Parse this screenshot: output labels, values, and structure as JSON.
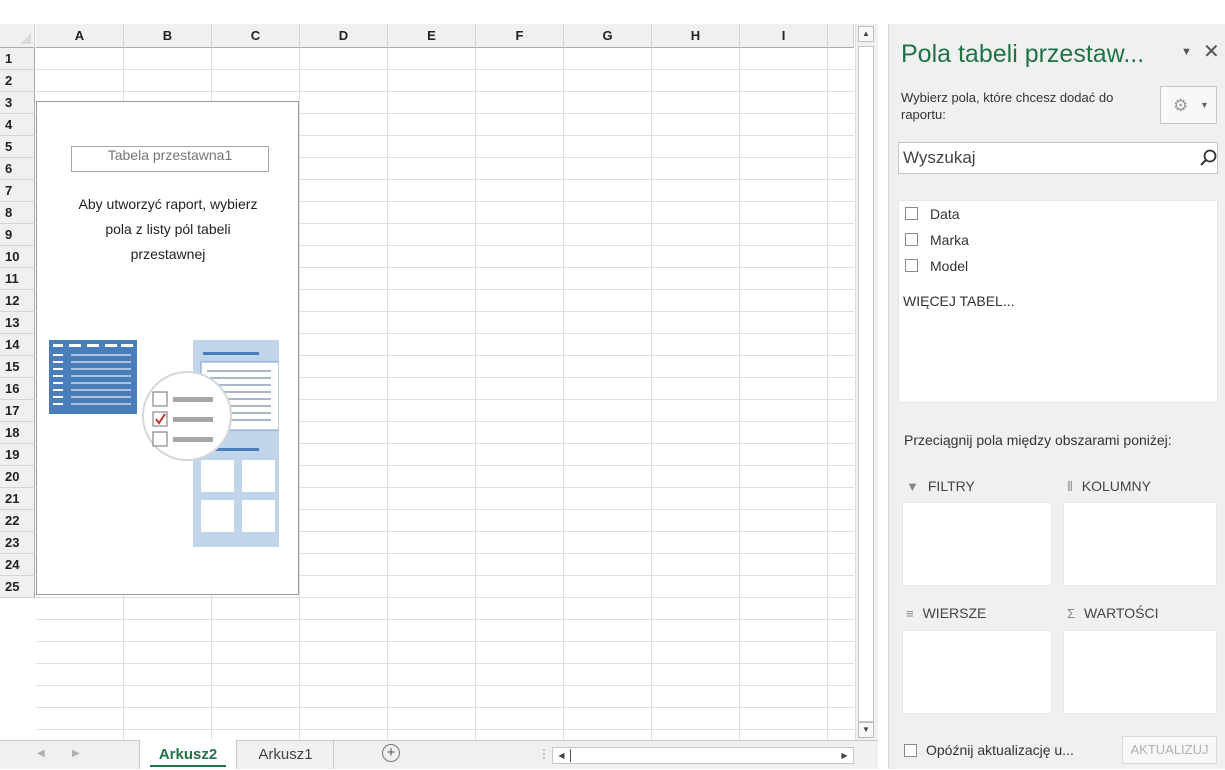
{
  "sheet": {
    "columns": [
      "A",
      "B",
      "C",
      "D",
      "E",
      "F",
      "G",
      "H",
      "I"
    ],
    "rows": [
      "1",
      "2",
      "3",
      "4",
      "5",
      "6",
      "7",
      "8",
      "9",
      "10",
      "11",
      "12",
      "13",
      "14",
      "15",
      "16",
      "17",
      "18",
      "19",
      "20",
      "21",
      "22",
      "23",
      "24",
      "25"
    ]
  },
  "pivot_placeholder": {
    "name": "Tabela przestawna1",
    "instruction_line1": "Aby utworzyć raport, wybierz",
    "instruction_line2": "pola z listy pól tabeli",
    "instruction_line3": "przestawnej"
  },
  "tabs": {
    "items": [
      "Arkusz2",
      "Arkusz1"
    ],
    "active": "Arkusz2",
    "add_glyph": "+"
  },
  "pane": {
    "title": "Pola tabeli przestaw...",
    "subtitle": "Wybierz pola, które chcesz dodać do raportu:",
    "search_placeholder": "Wyszukaj",
    "fields": [
      {
        "label": "Data",
        "checked": false
      },
      {
        "label": "Marka",
        "checked": false
      },
      {
        "label": "Model",
        "checked": false
      }
    ],
    "more_tables": "WIĘCEJ TABEL...",
    "drag_hint": "Przeciągnij pola między obszarami poniżej:",
    "areas": {
      "filters": "FILTRY",
      "columns": "KOLUMNY",
      "rows": "WIERSZE",
      "values": "WARTOŚCI"
    },
    "defer_update": "Opóźnij aktualizację u...",
    "update_button": "AKTUALIZUJ"
  },
  "icons": {
    "pane_menu": "chevron-down-icon",
    "pane_close": "close-icon",
    "tools": "gear-icon",
    "search": "search-icon",
    "filters": "filter-icon",
    "columns": "columns-icon",
    "rows": "rows-icon",
    "values": "sigma-icon"
  },
  "colors": {
    "accent": "#217346",
    "pane_bg": "#f0f0f0",
    "header_bg": "#f0f0f0",
    "gridline": "#e0e0e0",
    "illustration_blue": "#4a7ebb",
    "check_red": "#c0392b"
  }
}
